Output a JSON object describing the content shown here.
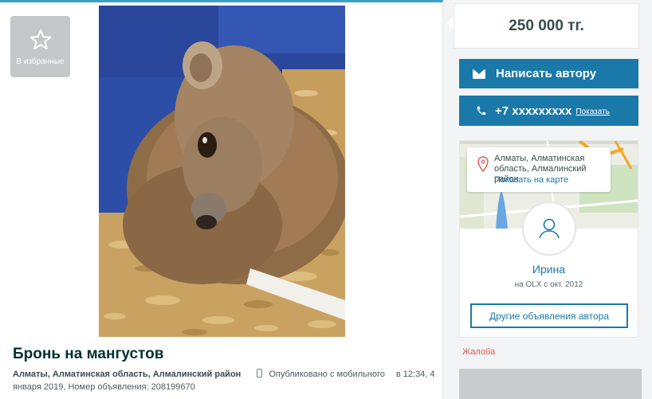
{
  "favorite": {
    "label": "В избранные",
    "icon": "star-icon"
  },
  "ad": {
    "title": "Бронь на мангустов",
    "location": "Алматы, Алматинская область, Алмалинский район",
    "published_prefix": "Опубликовано с мобильного",
    "published_when": "в 12:34, 4 января 2019,",
    "ad_number": "Номер объявления: 208199670"
  },
  "price": "250 000 тг.",
  "contact": {
    "write_label": "Написать автору",
    "phone_masked": "+7 xxxxxxxxx",
    "show_label": "Показать"
  },
  "map": {
    "address": "Алматы, Алматинская область, Алмалинский район",
    "show_on_map": "Показать на карте"
  },
  "seller": {
    "name": "Ирина",
    "since": "на OLX с окт. 2012",
    "other_ads_label": "Другие объявления автора"
  },
  "report_label": "Жалоба",
  "colors": {
    "accent": "#1a79a8",
    "report": "#e2574c",
    "topbar": "#3aa0c9"
  }
}
